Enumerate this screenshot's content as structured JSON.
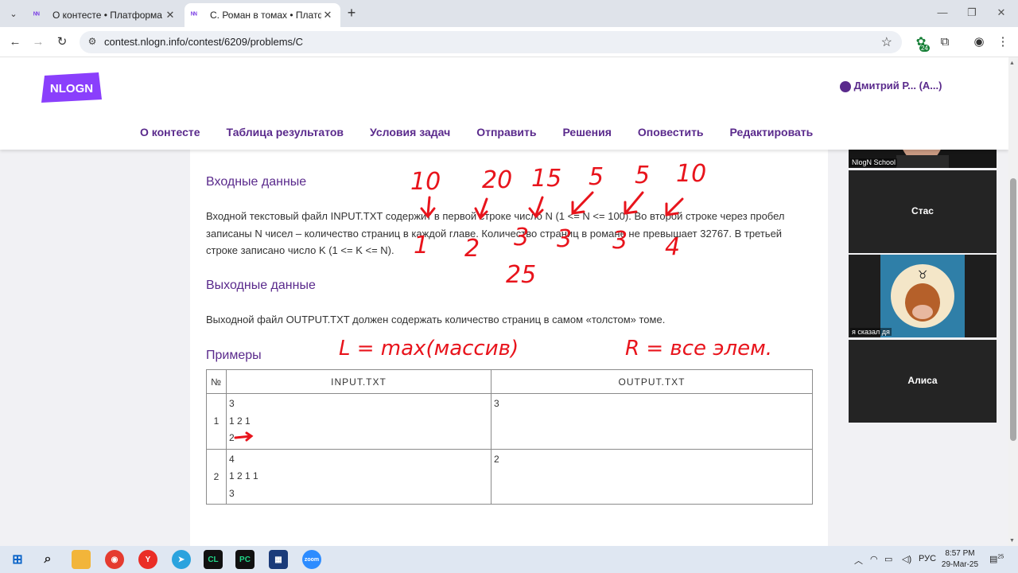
{
  "browser": {
    "tabs": [
      {
        "title": "О контесте • Платформа NlogN",
        "active": false
      },
      {
        "title": "C. Роман в томах • Платформа",
        "active": true
      }
    ],
    "url": "contest.nlogn.info/contest/6209/problems/C",
    "extension_badge": "24"
  },
  "site": {
    "logo_text": "NLOGN",
    "nav": [
      "О контесте",
      "Таблица результатов",
      "Условия задач",
      "Отправить",
      "Решения",
      "Оповестить",
      "Редактировать"
    ],
    "user_name": "Дмитрий Р... (А...)"
  },
  "problem": {
    "input_heading": "Входные данные",
    "input_text": "Входной текстовый файл INPUT.TXT содержит в первой строке число N (1 <= N <= 100). Во второй строке через пробел записаны N чисел – количество страниц в каждой главе. Количество страниц в романе не превышает 32767. В третьей строке записано число K (1 <= K <= N).",
    "output_heading": "Выходные данные",
    "output_text": "Выходной файл OUTPUT.TXT должен содержать количество страниц в самом «толстом» томе.",
    "examples_heading": "Примеры",
    "table": {
      "headers": [
        "№",
        "INPUT.TXT",
        "OUTPUT.TXT"
      ],
      "rows": [
        {
          "num": "1",
          "input": [
            "3",
            "1 2 1",
            "2"
          ],
          "output": "3"
        },
        {
          "num": "2",
          "input": [
            "4",
            "1 2 1 1",
            "3"
          ],
          "output": "2"
        }
      ]
    }
  },
  "annotations": {
    "numbers_top": [
      "10",
      "20",
      "15",
      "5",
      "5",
      "10"
    ],
    "numbers_bottom": [
      "1",
      "2",
      "3",
      "3",
      "3",
      "4"
    ],
    "sum_note": "25",
    "left_formula": "L = max(массив)",
    "right_formula": "R = все элем.",
    "ink_color": "#e8141c"
  },
  "zoom": {
    "participants": [
      {
        "name": "NlogN School",
        "type": "video"
      },
      {
        "name": "Стас",
        "type": "name"
      },
      {
        "name": "я сказал дя",
        "type": "avatar"
      },
      {
        "name": "Алиса",
        "type": "name"
      }
    ]
  },
  "taskbar": {
    "language": "РУС",
    "time": "8:57 PM",
    "date": "29-Mar-25",
    "notifications": "25"
  }
}
